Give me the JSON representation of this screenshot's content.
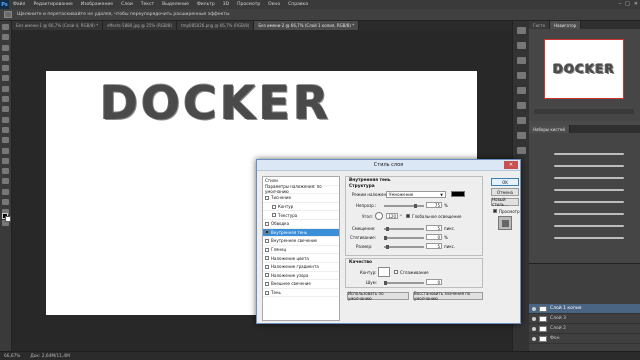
{
  "app": {
    "logo": "Ps"
  },
  "menu": [
    "Файл",
    "Редактирование",
    "Изображение",
    "Слои",
    "Текст",
    "Выделение",
    "Фильтр",
    "3D",
    "Просмотр",
    "Окно",
    "Справка"
  ],
  "window_controls": [
    "–",
    "□",
    "✕"
  ],
  "options_bar": {
    "hint": "Щелкните и перетаскивайте не удаляя, чтобы переупорядочить расширенные эффекты"
  },
  "tabs": [
    {
      "label": "Без имени-1 @ 66,7% (Слой 4, RGB/8) *",
      "active": false
    },
    {
      "label": "effects-5880.jpg @ 25% (RGB/8)",
      "active": false
    },
    {
      "label": "tmp085026.png @ 66,7% (RGB/8)",
      "active": false
    },
    {
      "label": "Без имени-2 @ 66,7% (Слой 1 копия, RGB/8) *",
      "active": true
    }
  ],
  "canvas": {
    "art_text": "DOCKER"
  },
  "status": {
    "zoom": "66,67%",
    "doc": "Док: 2,64М/11,4М"
  },
  "right_panel": {
    "tabs": [
      "Гисто",
      "Навигатор"
    ],
    "nav_text": "DOCKER",
    "brush_tabs": [
      "Наборы кистей"
    ],
    "layers": [
      {
        "name": "Слой 1 копия",
        "selected": true
      },
      {
        "name": "Слой 3",
        "selected": false
      },
      {
        "name": "Слой 2",
        "selected": false
      },
      {
        "name": "Фон",
        "selected": false
      }
    ]
  },
  "dialog": {
    "title": "Стиль слоя",
    "close": "✕",
    "style_list": [
      {
        "label": "Стили",
        "checkbox": false,
        "sub": false,
        "checked": false,
        "selected": false
      },
      {
        "label": "Параметры наложения: по умолчанию",
        "checkbox": false,
        "sub": false,
        "checked": false,
        "selected": false
      },
      {
        "label": "Тиснение",
        "checkbox": true,
        "sub": false,
        "checked": false,
        "selected": false
      },
      {
        "label": "Контур",
        "checkbox": true,
        "sub": true,
        "checked": false,
        "selected": false
      },
      {
        "label": "Текстура",
        "checkbox": true,
        "sub": true,
        "checked": false,
        "selected": false
      },
      {
        "label": "Обводка",
        "checkbox": true,
        "sub": false,
        "checked": false,
        "selected": false
      },
      {
        "label": "Внутренняя тень",
        "checkbox": true,
        "sub": false,
        "checked": true,
        "selected": true
      },
      {
        "label": "Внутреннее свечение",
        "checkbox": true,
        "sub": false,
        "checked": false,
        "selected": false
      },
      {
        "label": "Глянец",
        "checkbox": true,
        "sub": false,
        "checked": false,
        "selected": false
      },
      {
        "label": "Наложение цвета",
        "checkbox": true,
        "sub": false,
        "checked": false,
        "selected": false
      },
      {
        "label": "Наложение градиента",
        "checkbox": true,
        "sub": false,
        "checked": false,
        "selected": false
      },
      {
        "label": "Наложение узора",
        "checkbox": true,
        "sub": false,
        "checked": false,
        "selected": false
      },
      {
        "label": "Внешнее свечение",
        "checkbox": true,
        "sub": false,
        "checked": false,
        "selected": false
      },
      {
        "label": "Тень",
        "checkbox": true,
        "sub": false,
        "checked": false,
        "selected": false
      }
    ],
    "structure": {
      "group_title": "Внутренняя тень",
      "sub_title": "Структура",
      "blend_label": "Режим наложения:",
      "blend_value": "Умножение",
      "opacity_label": "Непрозр.:",
      "opacity_value": "75",
      "angle_label": "Угол:",
      "angle_value": "120",
      "global_light_label": "Глобальное освещение",
      "distance_label": "Смещение:",
      "distance_value": "5",
      "choke_label": "Стягивание:",
      "choke_value": "0",
      "size_label": "Размер:",
      "size_value": "5",
      "unit_percent": "%",
      "unit_px": "пикс.",
      "unit_deg": "°"
    },
    "quality": {
      "title": "Качество",
      "contour_label": "Контур:",
      "antialias_label": "Сглаживание",
      "noise_label": "Шум:",
      "noise_value": "0"
    },
    "make_default": "Использовать по умолчанию",
    "reset_default": "Восстановить значения по умолчанию",
    "buttons": {
      "ok": "OK",
      "cancel": "Отмена",
      "new_style": "Новый стиль...",
      "preview": "Просмотр"
    }
  }
}
